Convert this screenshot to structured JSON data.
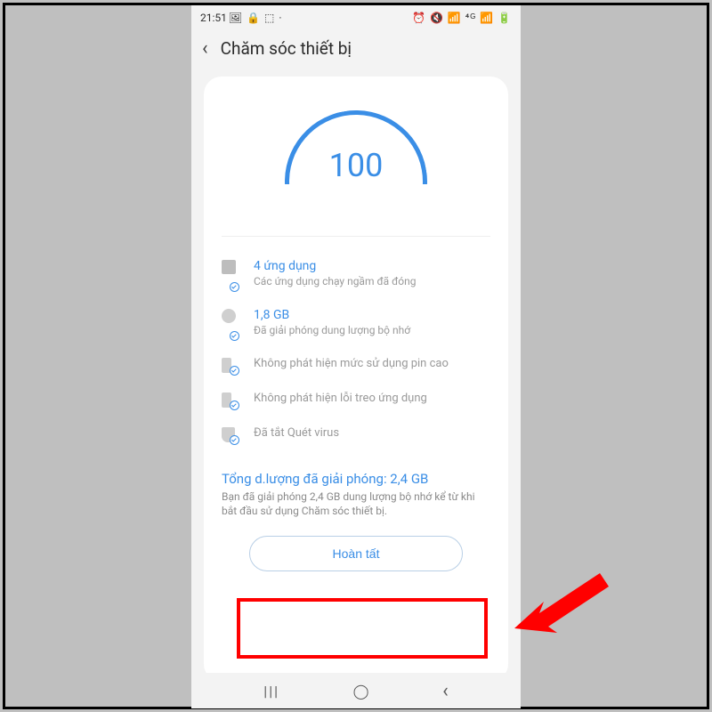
{
  "statusbar": {
    "time": "21:51",
    "left_icons": "🖼 🔒 ⬚ ·",
    "right_icons": "⏰ 🔇 📶 ⁴ᴳ 📶 🔋"
  },
  "header": {
    "title": "Chăm sóc thiết bị"
  },
  "gauge": {
    "score": "100"
  },
  "items": [
    {
      "icon": "chip-icon",
      "title": "4 ứng dụng",
      "sub": "Các ứng dụng chạy ngầm đã đóng"
    },
    {
      "icon": "storage-icon",
      "title": "1,8 GB",
      "sub": "Đã giải phóng dung lượng bộ nhớ"
    },
    {
      "icon": "battery-icon",
      "title": "",
      "sub": "Không phát hiện mức sử dụng pin cao"
    },
    {
      "icon": "battery-icon",
      "title": "",
      "sub": "Không phát hiện lỗi treo ứng dụng"
    },
    {
      "icon": "shield-icon",
      "title": "",
      "sub": "Đã tắt Quét virus"
    }
  ],
  "summary": {
    "title": "Tổng d.lượng đã giải phóng: 2,4 GB",
    "sub": "Bạn đã giải phóng 2,4 GB dung lượng bộ nhớ kể từ khi bắt đầu sử dụng Chăm sóc thiết bị."
  },
  "button": {
    "label": "Hoàn tất"
  },
  "nav": {
    "recents": "|||",
    "home": "◯",
    "back": "‹"
  },
  "colors": {
    "accent": "#3a8ee6",
    "muted": "#9a9a9a",
    "annotation": "#ff0000"
  }
}
